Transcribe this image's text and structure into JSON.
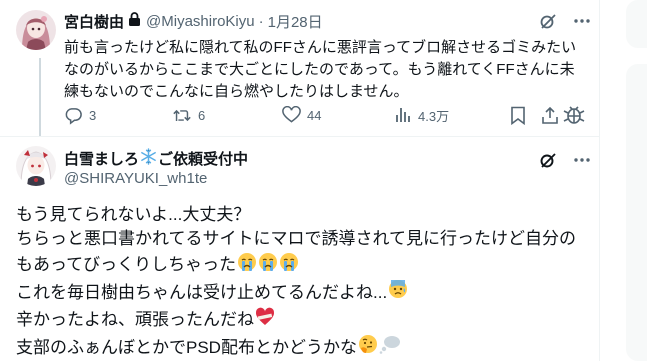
{
  "tweet1": {
    "display_name": "宮白樹由",
    "handle": "@MiyashiroKiyu",
    "separator": "·",
    "date": "1月28日",
    "lines": [
      "前も言ったけど私に隠れて私のFFさんに悪評言ってブロ解させるゴミみたい",
      "なのがいるからここまで大ごとにしたのであって。もう離れてくFFさんに未",
      "練もないのでこんなに自ら燃やしたりはしません。"
    ],
    "stats": {
      "replies": "3",
      "retweets": "6",
      "likes": "44",
      "views": "4.3万"
    }
  },
  "tweet2": {
    "display_name": "白雪ましろ",
    "name_suffix": "ご依頼受付中",
    "handle": "@SHIRAYUKI_wh1te",
    "lines": [
      "もう見てられないよ...大丈夫？",
      "ちらっと悪口書かれてるサイトにマロで誘導されて見に行ったけど自分の",
      "もあってびっくりしちゃった",
      "これを毎日樹由ちゃんは受け止めてるんだよね...",
      "辛かったよね、頑張ったんだね",
      "支部のふぁんぼとかでPSD配布とかどうかな"
    ]
  },
  "colors": {
    "muted": "#536471",
    "thread_line": "#cfd9de",
    "divider": "#eff3f4"
  },
  "icons": [
    "lock-icon",
    "grok-icon",
    "more-icon",
    "reply-icon",
    "retweet-icon",
    "like-icon",
    "views-icon",
    "bookmark-icon",
    "share-icon",
    "snowflake-icon",
    "crying-emoji",
    "anxious-emoji",
    "mending-heart-emoji",
    "thinking-emoji",
    "thought-balloon-emoji"
  ]
}
